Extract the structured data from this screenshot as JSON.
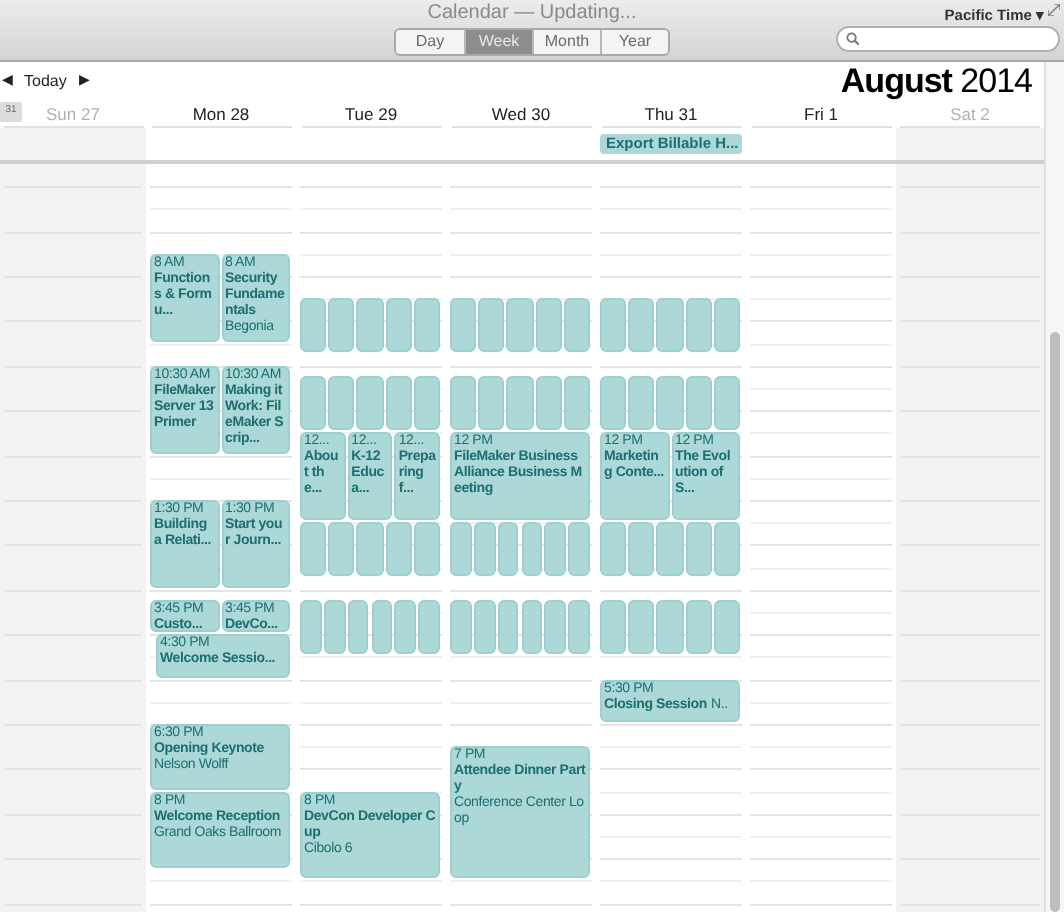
{
  "window": {
    "title": "Calendar — Updating..."
  },
  "view_tabs": [
    {
      "label": "Day",
      "selected": false
    },
    {
      "label": "Week",
      "selected": true
    },
    {
      "label": "Month",
      "selected": false
    },
    {
      "label": "Year",
      "selected": false
    }
  ],
  "time_zone": "Pacific Time ▾",
  "nav": {
    "prev": "◀",
    "today": "Today",
    "next": "▶",
    "month": "**August** 2014"
  },
  "mini_calendar": "31",
  "days": [
    {
      "label": "Sun 27",
      "weekend": true
    },
    {
      "label": "Mon 28",
      "weekend": false,
      "groups": [
        {
          "events": [
            {
              "kind": "event",
              "time": "8 AM",
              "title": "Functions & Formu..."
            },
            {
              "kind": "event",
              "time": "8 AM",
              "title": "Security Fundamentals",
              "location": "Begonia"
            }
          ]
        },
        {
          "events": [
            {
              "kind": "event",
              "time": "10:30 AM",
              "title": "FileMaker Server 13 Primer"
            },
            {
              "kind": "event",
              "time": "10:30 AM",
              "title": "Making it Work: FileMaker Scrip..."
            }
          ]
        },
        {
          "events": [
            {
              "kind": "event",
              "time": "1:30 PM",
              "title": "Building a Relati..."
            },
            {
              "kind": "event",
              "time": "1:30 PM",
              "title": "Start your Journ..."
            }
          ]
        },
        {
          "events": [
            {
              "kind": "event",
              "time": "3:45 PM",
              "title": "Custo..."
            },
            {
              "kind": "event",
              "time": "3:45 PM",
              "title": "DevCo..."
            }
          ]
        },
        {
          "events": [
            {
              "kind": "event",
              "time": "4:30 PM",
              "title": "Welcome Sessio..."
            }
          ]
        },
        {
          "events": [
            {
              "kind": "event",
              "time": "6:30 PM",
              "title": "Opening Keynote",
              "location": "Nelson Wolff"
            }
          ]
        },
        {
          "events": [
            {
              "kind": "event",
              "time": "8 PM",
              "title": "Welcome Reception",
              "location": "Grand Oaks Ballroom"
            }
          ]
        }
      ]
    },
    {
      "label": "Tue 29",
      "weekend": false,
      "groups": [
        {
          "events": [
            {
              "kind": "tile"
            },
            {
              "kind": "tile"
            },
            {
              "kind": "tile"
            },
            {
              "kind": "tile"
            },
            {
              "kind": "tile"
            }
          ]
        },
        {
          "events": [
            {
              "kind": "tile"
            },
            {
              "kind": "tile"
            },
            {
              "kind": "tile"
            },
            {
              "kind": "tile"
            },
            {
              "kind": "tile"
            }
          ]
        },
        {
          "events": [
            {
              "kind": "event",
              "time": "12...",
              "title": "About the..."
            },
            {
              "kind": "event",
              "time": "12...",
              "title": "K-12 Educa..."
            },
            {
              "kind": "event",
              "time": "12...",
              "title": "Preparing f..."
            }
          ]
        },
        {
          "events": [
            {
              "kind": "tile"
            },
            {
              "kind": "tile"
            },
            {
              "kind": "tile"
            },
            {
              "kind": "tile"
            },
            {
              "kind": "tile"
            }
          ]
        },
        {
          "events": [
            {
              "kind": "tile"
            },
            {
              "kind": "tile"
            },
            {
              "kind": "tile"
            },
            {
              "kind": "tile"
            },
            {
              "kind": "tile"
            },
            {
              "kind": "tile"
            }
          ]
        },
        {
          "events": [
            {
              "kind": "event",
              "time": "8 PM",
              "title": "DevCon Developer Cup",
              "location": "Cibolo 6"
            }
          ]
        }
      ]
    },
    {
      "label": "Wed 30",
      "weekend": false,
      "groups": [
        {
          "events": [
            {
              "kind": "tile"
            },
            {
              "kind": "tile"
            },
            {
              "kind": "tile"
            },
            {
              "kind": "tile"
            },
            {
              "kind": "tile"
            }
          ]
        },
        {
          "events": [
            {
              "kind": "tile"
            },
            {
              "kind": "tile"
            },
            {
              "kind": "tile"
            },
            {
              "kind": "tile"
            },
            {
              "kind": "tile"
            }
          ]
        },
        {
          "events": [
            {
              "kind": "event",
              "time": "12 PM",
              "title": "FileMaker Business Alliance Business Meeting"
            }
          ]
        },
        {
          "events": [
            {
              "kind": "tile"
            },
            {
              "kind": "tile"
            },
            {
              "kind": "tile"
            },
            {
              "kind": "tile"
            },
            {
              "kind": "tile"
            },
            {
              "kind": "tile"
            }
          ]
        },
        {
          "events": [
            {
              "kind": "tile"
            },
            {
              "kind": "tile"
            },
            {
              "kind": "tile"
            },
            {
              "kind": "tile"
            },
            {
              "kind": "tile"
            },
            {
              "kind": "tile"
            }
          ]
        },
        {
          "events": [
            {
              "kind": "event",
              "time": "7 PM",
              "title": "Attendee Dinner Party",
              "location": "Conference Center Loop"
            }
          ]
        }
      ]
    },
    {
      "label": "Thu 31",
      "weekend": false,
      "all_day": [
        {
          "title": "Export Billable H..."
        }
      ],
      "groups": [
        {
          "events": [
            {
              "kind": "tile"
            },
            {
              "kind": "tile"
            },
            {
              "kind": "tile"
            },
            {
              "kind": "tile"
            },
            {
              "kind": "tile"
            }
          ]
        },
        {
          "events": [
            {
              "kind": "tile"
            },
            {
              "kind": "tile"
            },
            {
              "kind": "tile"
            },
            {
              "kind": "tile"
            },
            {
              "kind": "tile"
            }
          ]
        },
        {
          "events": [
            {
              "kind": "event",
              "time": "12 PM",
              "title": "Marketing Conte..."
            },
            {
              "kind": "event",
              "time": "12 PM",
              "title": "The Evolution of S..."
            }
          ]
        },
        {
          "events": [
            {
              "kind": "tile"
            },
            {
              "kind": "tile"
            },
            {
              "kind": "tile"
            },
            {
              "kind": "tile"
            },
            {
              "kind": "tile"
            }
          ]
        },
        {
          "events": [
            {
              "kind": "tile"
            },
            {
              "kind": "tile"
            },
            {
              "kind": "tile"
            },
            {
              "kind": "tile"
            },
            {
              "kind": "tile"
            }
          ]
        },
        {
          "events": [
            {
              "kind": "inline",
              "time": "5:30 PM",
              "title": "Closing Session",
              "location": "N.."
            }
          ]
        }
      ]
    },
    {
      "label": "Fri 1",
      "weekend": false
    },
    {
      "label": "Sat 2",
      "weekend": true
    }
  ]
}
